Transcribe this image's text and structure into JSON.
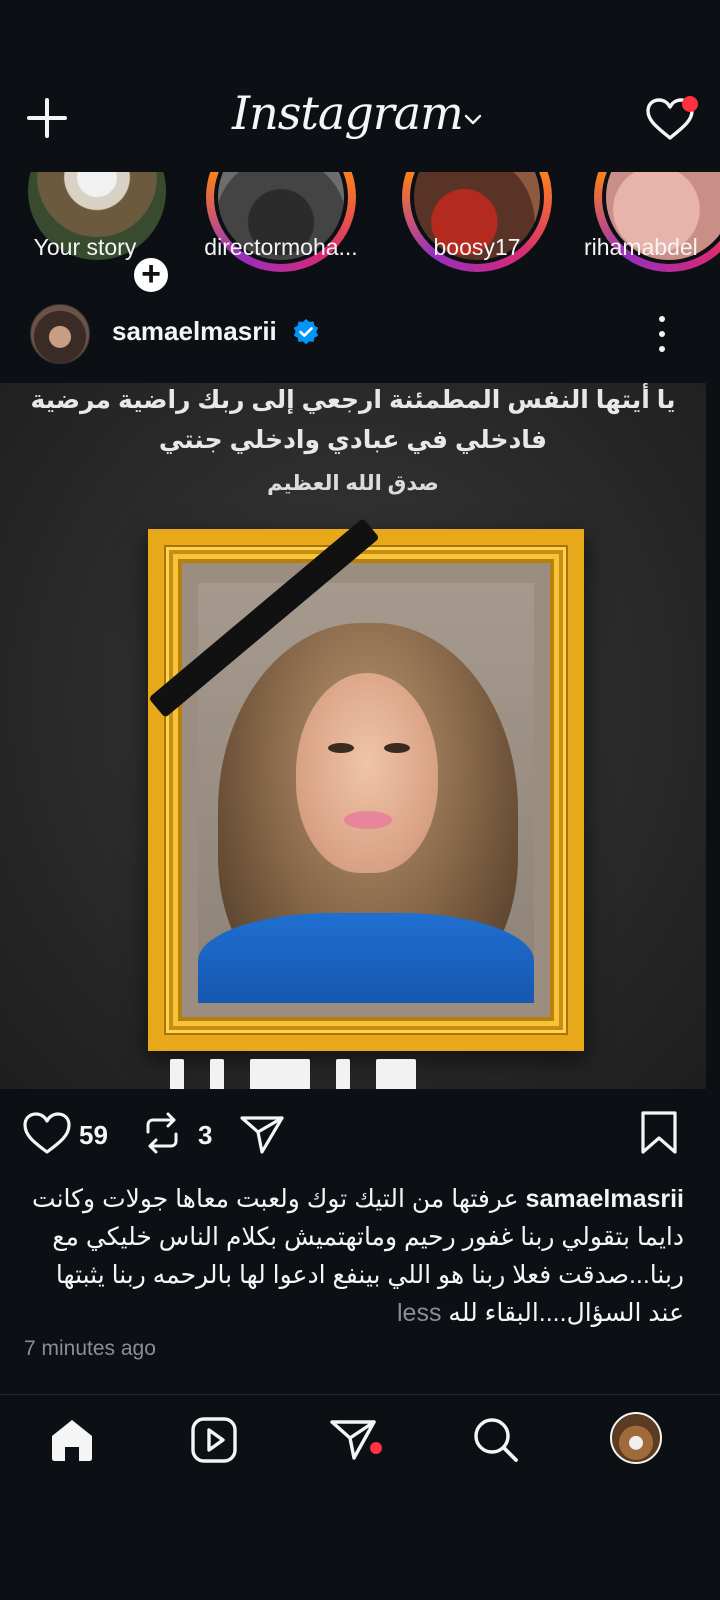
{
  "header": {
    "logo_text": "Instagram"
  },
  "stories": [
    {
      "label": "Your story",
      "own": true
    },
    {
      "label": "directormoha..."
    },
    {
      "label": "boosy17"
    },
    {
      "label": "rihamabdel"
    }
  ],
  "post": {
    "username": "samaelmasrii",
    "verified": true,
    "image_text": {
      "line1": "يا أيتها النفس المطمئنة ارجعي إلى ربك راضية مرضية",
      "line2": "فادخلي في عبادي وادخلي جنتي",
      "line3": "صدق الله العظيم"
    },
    "likes": "59",
    "reposts": "3",
    "caption": "عرفتها من التيك توك ولعبت معاها جولات وكانت دايما بتقولي ربنا غفور رحيم وماتهتميش بكلام الناس خليكي مع ربنا...صدقت فعلا ربنا هو اللي بينفع ادعوا لها بالرحمه ربنا يثبتها عند السؤال....البقاء لله",
    "less_label": "less",
    "timestamp": "7 minutes ago"
  },
  "colors": {
    "background": "#0c1014",
    "notification": "#ff3040",
    "verified": "#0095f6",
    "frame_gold": "#e7a91a"
  },
  "icons": {
    "create": "plus-icon",
    "notifications": "heart-icon",
    "home": "home-icon",
    "reels": "reels-icon",
    "messages": "paper-plane-icon",
    "search": "search-icon"
  }
}
